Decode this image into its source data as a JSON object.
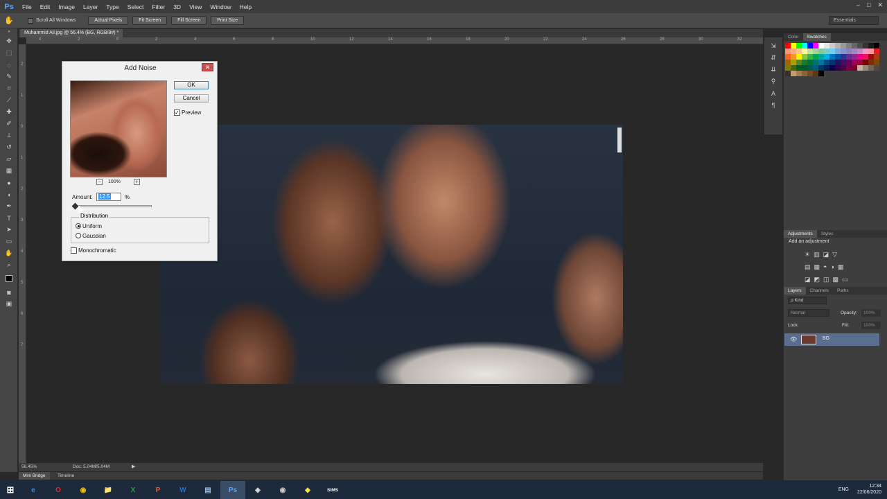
{
  "app": {
    "logo": "Ps"
  },
  "menu": [
    "File",
    "Edit",
    "Image",
    "Layer",
    "Type",
    "Select",
    "Filter",
    "3D",
    "View",
    "Window",
    "Help"
  ],
  "window_controls": [
    "–",
    "□",
    "✕"
  ],
  "options_bar": {
    "scroll_all_windows": "Scroll All Windows",
    "buttons": [
      "Actual Pixels",
      "Fit Screen",
      "Fill Screen",
      "Print Size"
    ],
    "workspace": "Essentials"
  },
  "document": {
    "tab": "Muhammid Ali.jpg @ 56.4% (BG, RGB/8#) *",
    "zoom": "56.45%",
    "doc_size": "Doc: 5.04M/5.04M"
  },
  "bottom_tabs": [
    "Mini Bridge",
    "Timeline"
  ],
  "ruler_top": [
    "4",
    "2",
    "0",
    "2",
    "4",
    "6",
    "8",
    "10",
    "12",
    "14",
    "16",
    "18",
    "20",
    "22",
    "24",
    "26",
    "28",
    "30",
    "32"
  ],
  "ruler_left": [
    "2",
    "1",
    "0",
    "1",
    "2",
    "3",
    "4",
    "5",
    "6",
    "7"
  ],
  "dialog": {
    "title": "Add Noise",
    "close": "✕",
    "ok": "OK",
    "cancel": "Cancel",
    "preview_label": "Preview",
    "preview_checked": true,
    "zoom_out": "−",
    "zoom_in": "+",
    "zoom_level": "100%",
    "amount_label": "Amount:",
    "amount_value": "12.5",
    "amount_unit": "%",
    "distribution_label": "Distribution",
    "uniform": "Uniform",
    "gaussian": "Gaussian",
    "distribution_selected": "uniform",
    "monochromatic": "Monochromatic",
    "monochromatic_checked": false
  },
  "panels": {
    "color_tabs": [
      "Color",
      "Swatches"
    ],
    "adjust_tabs": [
      "Adjustments",
      "Styles"
    ],
    "adjust_hint": "Add an adjustment",
    "layers_tabs": [
      "Layers",
      "Channels",
      "Paths"
    ],
    "kind": "ρ Kind",
    "blend_mode": "Normal",
    "opacity_label": "Opacity:",
    "opacity_value": "100%",
    "lock_label": "Lock:",
    "fill_label": "Fill:",
    "fill_value": "100%",
    "layer_name": "BG"
  },
  "taskbar": {
    "apps": [
      "e",
      "O",
      "◉",
      "📁",
      "X",
      "P",
      "W",
      "▤",
      "Ps",
      "◈",
      "◉",
      "◆",
      "SIMS"
    ],
    "lang": "ENG",
    "time": "12:34",
    "date": "22/06/2020"
  }
}
